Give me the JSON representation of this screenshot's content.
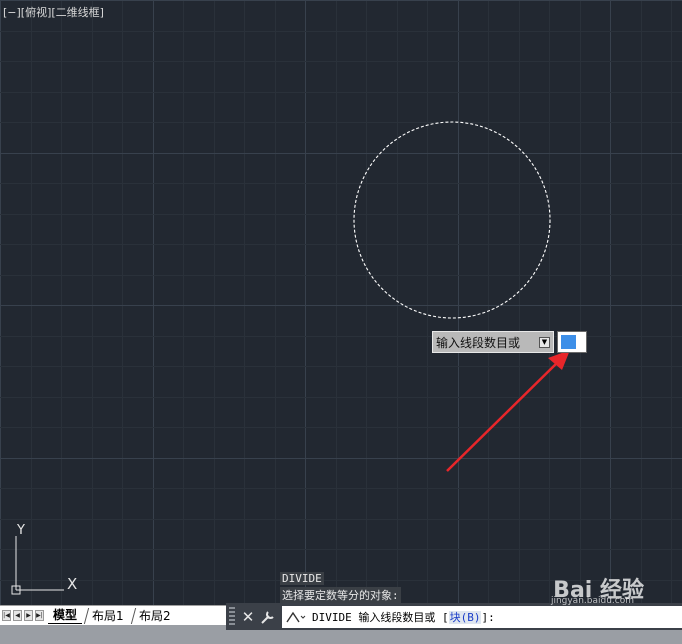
{
  "viewport": {
    "view_label": "[−][俯视][二维线框]"
  },
  "dynamic_prompt": {
    "label": "输入线段数目或",
    "dropdown_icon": "dropdown-arrow-icon",
    "input_value": ""
  },
  "ucs": {
    "y_label": "Y",
    "x_label": "X"
  },
  "command_history": [
    "DIVIDE",
    "选择要定数等分的对象:"
  ],
  "layout_tabs": [
    {
      "label": "模型",
      "active": true
    },
    {
      "label": "布局1",
      "active": false
    },
    {
      "label": "布局2",
      "active": false
    }
  ],
  "command_line": {
    "close_label": "✕",
    "prefix": "DIVIDE 输入线段数目或 [",
    "option": "块(B)",
    "suffix": "]:"
  },
  "watermark": {
    "brand": "Bai 经验",
    "site": "jingyan.baidu.com"
  },
  "colors": {
    "canvas": "#222831",
    "arrow": "#e8262a",
    "selection": "#3d8fe8"
  }
}
